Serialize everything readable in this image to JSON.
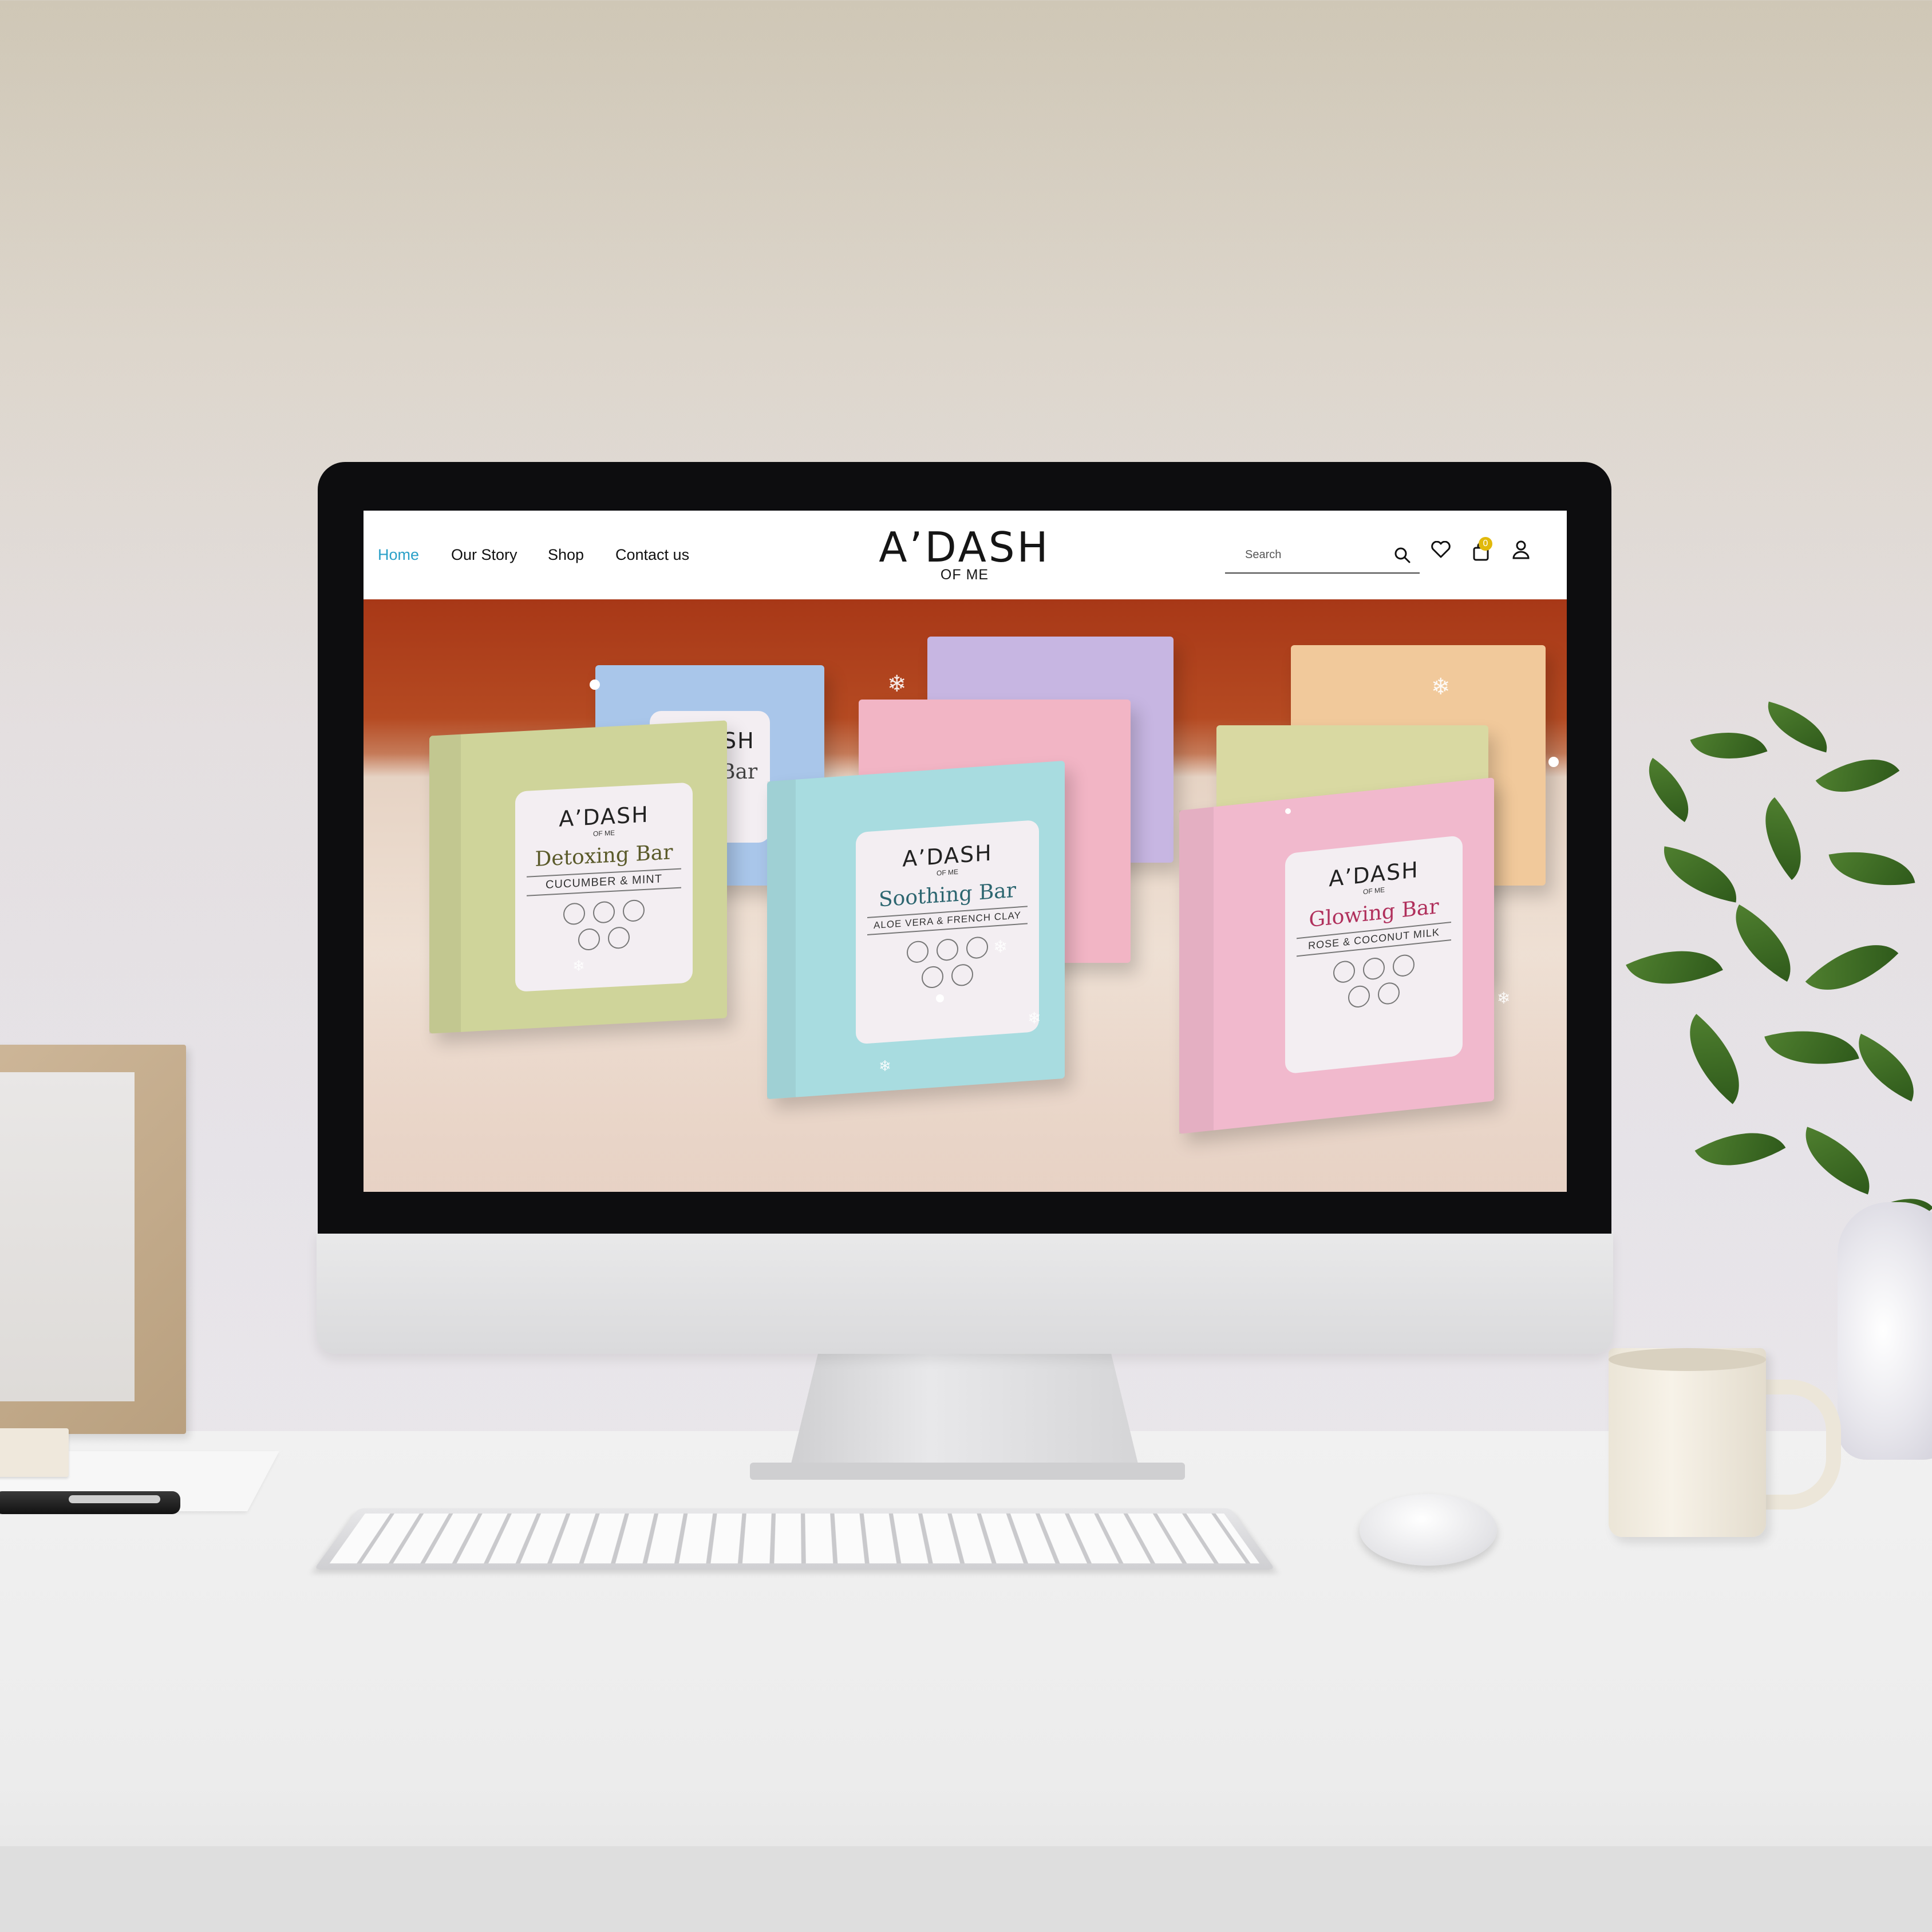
{
  "nav": {
    "items": [
      {
        "label": "Home",
        "active": true
      },
      {
        "label": "Our Story",
        "active": false
      },
      {
        "label": "Shop",
        "active": false
      },
      {
        "label": "Contact us",
        "active": false
      }
    ]
  },
  "logo": {
    "main": "A’DASH",
    "sub": "OF ME"
  },
  "search": {
    "placeholder": "Search"
  },
  "header_icons": {
    "search": "search-icon",
    "wishlist": "heart-icon",
    "cart": "shopping-bag-icon",
    "account": "user-icon"
  },
  "cart": {
    "count": "0"
  },
  "colors": {
    "active_nav": "#2aa0c8",
    "cart_badge": "#e1b90b",
    "hero_backdrop": "#a83817"
  },
  "products": [
    {
      "brand": "A’DASH",
      "of": "OF ME",
      "name": "Detoxing Bar",
      "sub": "CUCUMBER & MINT",
      "color": "#cfd49a",
      "name_color": "#5a5a2a"
    },
    {
      "brand": "A’DASH",
      "of": "OF ME",
      "name": "Soothing Bar",
      "sub": "ALOE VERA & FRENCH CLAY",
      "color": "#a8dce0",
      "name_color": "#2d6670"
    },
    {
      "brand": "A’DASH",
      "of": "OF ME",
      "name": "Glowing Bar",
      "sub": "ROSE & COCONUT MILK",
      "color": "#f1b9cd",
      "name_color": "#b0305c"
    },
    {
      "brand": "A’DASH",
      "of": "OF ME",
      "name": "Silky Bar",
      "sub": "",
      "color": "#a9c6ea",
      "name_color": "#444"
    }
  ]
}
